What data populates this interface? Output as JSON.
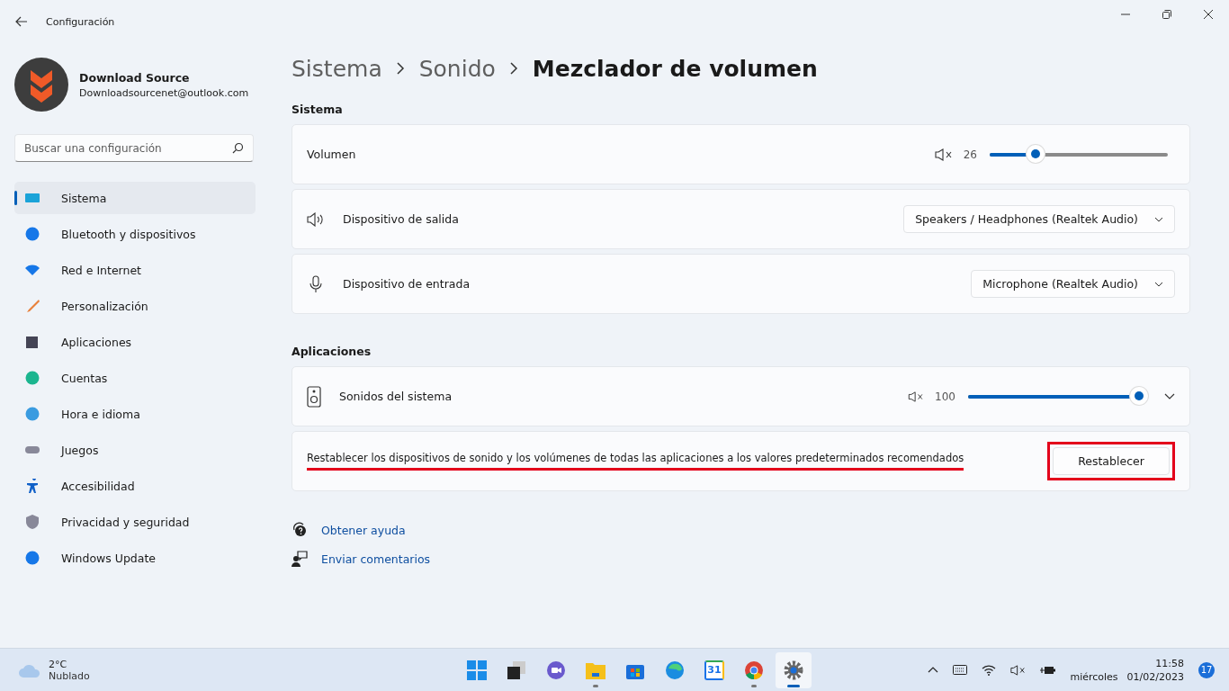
{
  "window": {
    "title": "Configuración"
  },
  "profile": {
    "name": "Download Source",
    "email": "Downloadsourcenet@outlook.com"
  },
  "search": {
    "placeholder": "Buscar una configuración"
  },
  "sidebar": {
    "items": [
      {
        "label": "Sistema",
        "selected": true
      },
      {
        "label": "Bluetooth y dispositivos",
        "selected": false
      },
      {
        "label": "Red e Internet",
        "selected": false
      },
      {
        "label": "Personalización",
        "selected": false
      },
      {
        "label": "Aplicaciones",
        "selected": false
      },
      {
        "label": "Cuentas",
        "selected": false
      },
      {
        "label": "Hora e idioma",
        "selected": false
      },
      {
        "label": "Juegos",
        "selected": false
      },
      {
        "label": "Accesibilidad",
        "selected": false
      },
      {
        "label": "Privacidad y seguridad",
        "selected": false
      },
      {
        "label": "Windows Update",
        "selected": false
      }
    ]
  },
  "breadcrumb": [
    {
      "label": "Sistema",
      "current": false
    },
    {
      "label": "Sonido",
      "current": false
    },
    {
      "label": "Mezclador de volumen",
      "current": true
    }
  ],
  "system_section": {
    "title": "Sistema",
    "rows": [
      {
        "kind": "slider",
        "label": "Volumen",
        "reading": "26",
        "level": 0.26
      },
      {
        "kind": "dropdown",
        "label": "Dispositivo de salida",
        "value": "Speakers / Headphones (Realtek Audio)"
      },
      {
        "kind": "dropdown",
        "label": "Dispositivo de entrada",
        "value": "Microphone (Realtek Audio)"
      }
    ]
  },
  "apps_section": {
    "title": "Aplicaciones",
    "rows": [
      {
        "label": "Sonidos del sistema",
        "reading": "100",
        "level": 1
      }
    ]
  },
  "reset": {
    "text": "Restablecer los dispositivos de sonido y los volúmenes de todas las aplicaciones a los valores predeterminados recomendados",
    "button": "Restablecer",
    "highlighted": true
  },
  "links": [
    "Obtener ayuda",
    "Enviar comentarios"
  ],
  "taskbar": {
    "weather": {
      "temperature": "2°C",
      "condition": "Nublado"
    },
    "apps": [
      {
        "running": false,
        "selected": false
      },
      {
        "running": false,
        "selected": false
      },
      {
        "running": false,
        "selected": false
      },
      {
        "running": true,
        "selected": false
      },
      {
        "running": false,
        "selected": false
      },
      {
        "running": false,
        "selected": false
      },
      {
        "running": false,
        "selected": false,
        "label": "31"
      },
      {
        "running": true,
        "selected": false
      },
      {
        "running": true,
        "selected": true
      }
    ],
    "time": "11:58",
    "day": "miércoles",
    "date": "01/02/2023",
    "notifications": "17"
  }
}
